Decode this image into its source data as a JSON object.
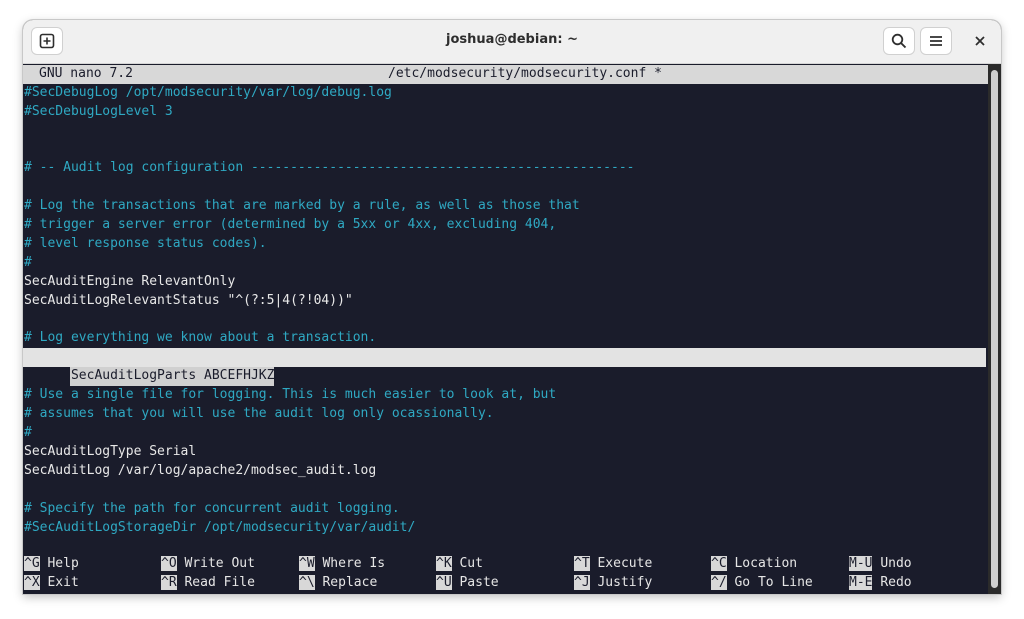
{
  "window": {
    "title": "joshua@debian: ~",
    "new_tab_icon": "new-tab-icon",
    "search_icon": "search-icon",
    "menu_icon": "hamburger-menu-icon",
    "close_icon": "close-icon"
  },
  "nano": {
    "version": "GNU nano 7.2",
    "file": "/etc/modsecurity/modsecurity.conf *"
  },
  "lines": [
    "#SecDebugLog /opt/modsecurity/var/log/debug.log",
    "#SecDebugLogLevel 3",
    "",
    "",
    "# -- Audit log configuration -------------------------------------------------",
    "",
    "# Log the transactions that are marked by a rule, as well as those that",
    "# trigger a server error (determined by a 5xx or 4xx, excluding 404,",
    "# level response status codes).",
    "#",
    "SecAuditEngine RelevantOnly",
    "SecAuditLogRelevantStatus \"^(?:5|4(?!04))\"",
    "",
    "# Log everything we know about a transaction.",
    "SecAuditLogParts ABCEFHJKZ",
    "",
    "# Use a single file for logging. This is much easier to look at, but",
    "# assumes that you will use the audit log only ocassionally.",
    "#",
    "SecAuditLogType Serial",
    "SecAuditLog /var/log/apache2/modsec_audit.log",
    "",
    "# Specify the path for concurrent audit logging.",
    "#SecAuditLogStorageDir /opt/modsecurity/var/audit/"
  ],
  "shortcuts": {
    "row1": [
      {
        "key": "^G",
        "label": "Help"
      },
      {
        "key": "^O",
        "label": "Write Out"
      },
      {
        "key": "^W",
        "label": "Where Is"
      },
      {
        "key": "^K",
        "label": "Cut"
      },
      {
        "key": "^T",
        "label": "Execute"
      },
      {
        "key": "^C",
        "label": "Location"
      },
      {
        "key": "M-U",
        "label": "Undo"
      }
    ],
    "row2": [
      {
        "key": "^X",
        "label": "Exit"
      },
      {
        "key": "^R",
        "label": "Read File"
      },
      {
        "key": "^\\",
        "label": "Replace"
      },
      {
        "key": "^U",
        "label": "Paste"
      },
      {
        "key": "^J",
        "label": "Justify"
      },
      {
        "key": "^/",
        "label": "Go To Line"
      },
      {
        "key": "M-E",
        "label": "Redo"
      }
    ]
  }
}
